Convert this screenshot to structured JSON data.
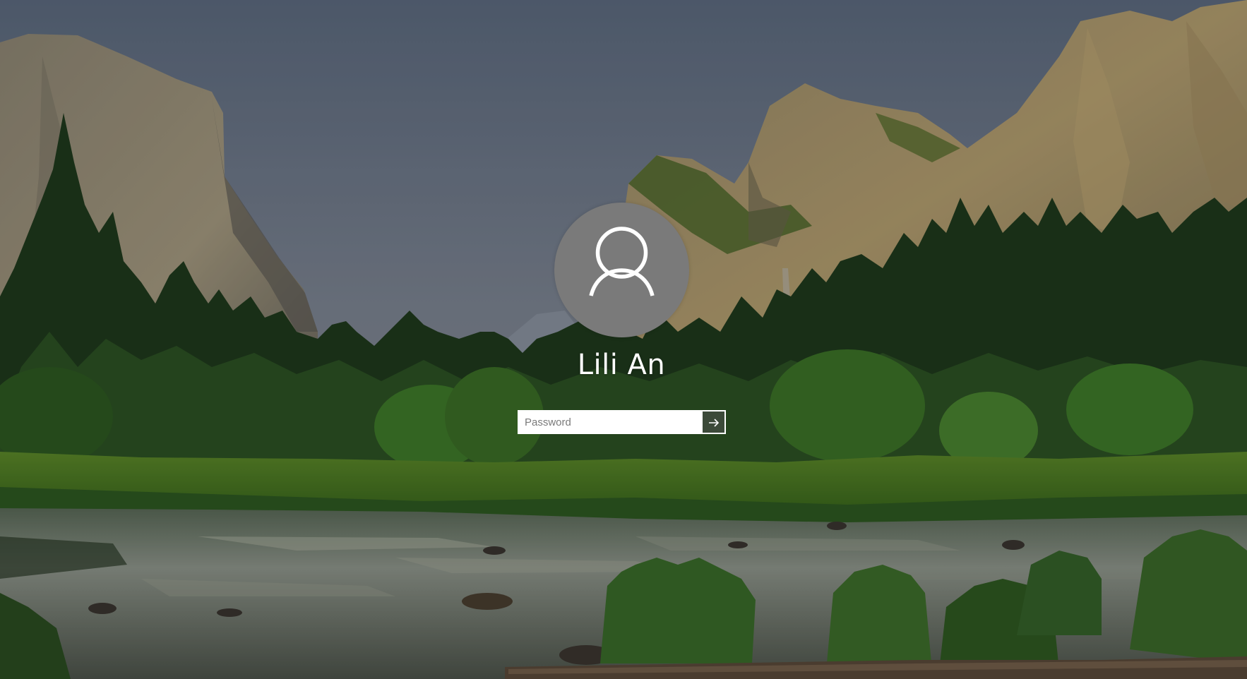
{
  "user": {
    "name": "Lili An",
    "avatar_icon": "person-icon"
  },
  "password": {
    "value": "",
    "placeholder": "Password"
  },
  "submit": {
    "icon": "arrow-right-icon"
  },
  "colors": {
    "avatar_bg": "#7a7a7a",
    "text": "#ffffff",
    "field_border": "#ffffff"
  }
}
